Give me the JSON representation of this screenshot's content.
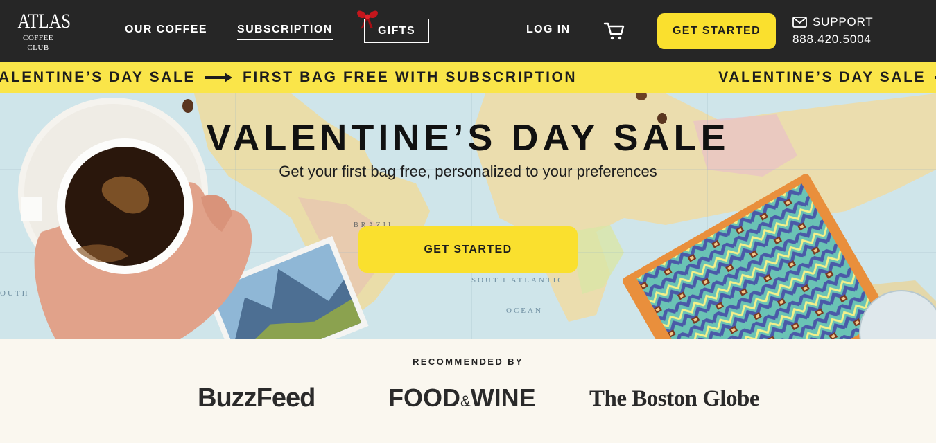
{
  "brand": {
    "name": "ATLAS",
    "tagline": "COFFEE CLUB"
  },
  "nav": {
    "our_coffee": "OUR COFFEE",
    "subscription": "SUBSCRIPTION",
    "gifts": "GIFTS",
    "login": "LOG IN",
    "get_started": "GET STARTED"
  },
  "support": {
    "label": "SUPPORT",
    "phone": "888.420.5004"
  },
  "ticker": {
    "part1": "VALENTINE’S DAY SALE",
    "part2": "FIRST BAG FREE WITH SUBSCRIPTION"
  },
  "hero": {
    "title": "VALENTINE’S DAY SALE",
    "subtitle": "Get your first bag free, personalized to your preferences",
    "cta": "GET STARTED",
    "map_labels": {
      "brazil": "BRAZIL",
      "south_atlantic": "SOUTH ATLANTIC",
      "ocean": "OCEAN",
      "south": "OUTH"
    }
  },
  "recommended": {
    "label": "RECOMMENDED BY",
    "buzzfeed": "BuzzFeed",
    "food_wine_1": "FOOD",
    "food_wine_amp": "&",
    "food_wine_2": "WINE",
    "boston_globe": "The Boston Globe"
  },
  "colors": {
    "header_bg": "#262626",
    "accent_yellow": "#fae02e",
    "ticker_bg": "#fae549",
    "page_bg": "#faf7ef"
  },
  "icons": [
    "cart-icon",
    "mail-icon",
    "arrow-right-icon",
    "bow-icon"
  ]
}
